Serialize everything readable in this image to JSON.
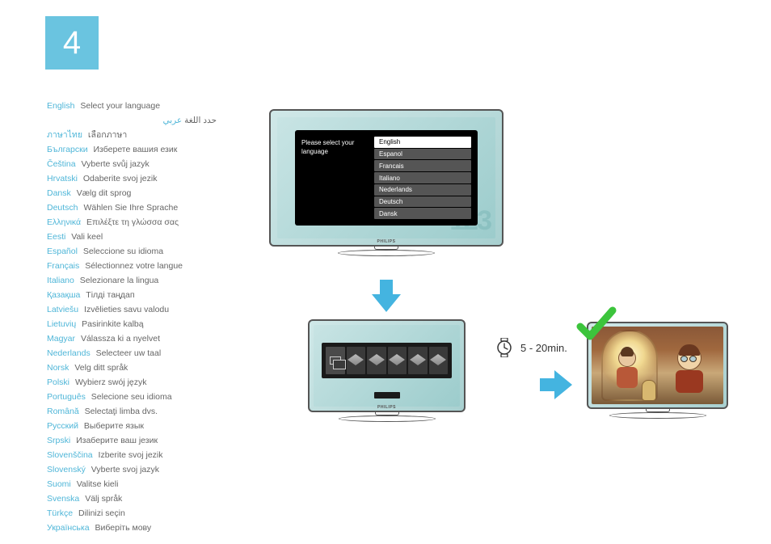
{
  "step_number": "4",
  "languages": [
    {
      "name": "English",
      "text": "Select your language"
    },
    {
      "name": "عربي",
      "text": "حدد اللغة",
      "rtl": true
    },
    {
      "name": "ภาษาไทย",
      "text": "เลือกภาษา"
    },
    {
      "name": "Български",
      "text": "Изберете вашия език"
    },
    {
      "name": "Čeština",
      "text": "Vyberte svůj jazyk"
    },
    {
      "name": "Hrvatski",
      "text": "Odaberite svoj jezik"
    },
    {
      "name": "Dansk",
      "text": "Vælg dit sprog"
    },
    {
      "name": "Deutsch",
      "text": "Wählen Sie Ihre Sprache"
    },
    {
      "name": "Ελληνικά",
      "text": "Επιλέξτε τη γλώσσα σας"
    },
    {
      "name": "Eesti",
      "text": "Vali keel"
    },
    {
      "name": "Español",
      "text": "Seleccione su idioma"
    },
    {
      "name": "Français",
      "text": "Sélectionnez votre langue"
    },
    {
      "name": "Italiano",
      "text": "Selezionare la lingua"
    },
    {
      "name": "Қазақша",
      "text": "Тілді таңдап"
    },
    {
      "name": "Latviešu",
      "text": "Izvēlieties savu valodu"
    },
    {
      "name": "Lietuvių",
      "text": "Pasirinkite kalbą"
    },
    {
      "name": "Magyar",
      "text": "Válassza ki a nyelvet"
    },
    {
      "name": "Nederlands",
      "text": "Selecteer uw taal"
    },
    {
      "name": "Norsk",
      "text": "Velg ditt språk"
    },
    {
      "name": "Polski",
      "text": "Wybierz swój język"
    },
    {
      "name": "Português",
      "text": "Selecione seu idioma"
    },
    {
      "name": "Română",
      "text": "Selectaţi limba dvs."
    },
    {
      "name": "Русский",
      "text": "Выберите язык"
    },
    {
      "name": "Srpski",
      "text": "Изаберите ваш језик"
    },
    {
      "name": "Slovenščina",
      "text": "Izberite svoj jezik"
    },
    {
      "name": "Slovenský",
      "text": "Vyberte svoj jazyk"
    },
    {
      "name": "Suomi",
      "text": "Valitse kieli"
    },
    {
      "name": "Svenska",
      "text": "Välj språk"
    },
    {
      "name": "Türkçe",
      "text": "Dilinizi seçin"
    },
    {
      "name": "Українська",
      "text": "Виберіть мову"
    }
  ],
  "tv_menu": {
    "prompt": "Please select your language",
    "options": [
      "English",
      "Espanol",
      "Francais",
      "Italiano",
      "Nederlands",
      "Deutsch",
      "Dansk"
    ],
    "selected": 0,
    "bg_text": "123",
    "brand": "PHILIPS"
  },
  "wait_time": "5 - 20min.",
  "colors": {
    "accent": "#6ac4e0",
    "arrow": "#44b4e0",
    "check": "#3cc43c",
    "link": "#4fb6d8"
  }
}
